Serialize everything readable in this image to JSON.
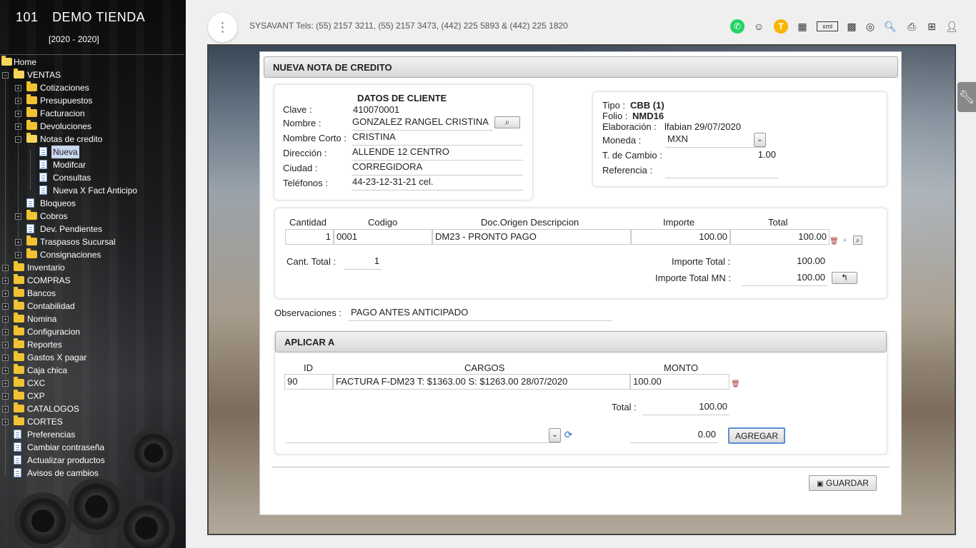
{
  "sidebar": {
    "brand_number": "101",
    "brand_name": "DEMO TIENDA",
    "years": "[2020 - 2020]",
    "tree": {
      "home": "Home",
      "ventas": "VENTAS",
      "cotizaciones": "Cotizaciones",
      "presupuestos": "Presupuestos",
      "facturacion": "Facturacion",
      "devoluciones": "Devoluciones",
      "notas_credito": "Notas de credito",
      "nueva": "Nueva",
      "modifcar": "Modifcar",
      "consultas": "Consultas",
      "nueva_fact": "Nueva X Fact Anticipo",
      "bloqueos": "Bloqueos",
      "cobros": "Cobros",
      "dev_pendientes": "Dev. Pendientes",
      "traspasos": "Traspasos Sucursal",
      "consignaciones": "Consignaciones",
      "inventario": "Inventario",
      "compras": "COMPRAS",
      "bancos": "Bancos",
      "contabilidad": "Contabilidad",
      "nomina": "Nomina",
      "configuracion": "Configuracion",
      "reportes": "Reportes",
      "gastos": "Gastos X pagar",
      "caja": "Caja chica",
      "cxc": "CXC",
      "cxp": "CXP",
      "catalogos": "CATALOGOS",
      "cortes": "CORTES",
      "preferencias": "Preferencias",
      "cambiar": "Cambiar contraseña",
      "actualizar": "Actualizar productos",
      "avisos": "Avisos de cambios"
    }
  },
  "topbar": {
    "menu_glyph": "⋮",
    "contact": "SYSAVANT Tels: (55) 2157 3211, (55) 2157 3473, (442) 225 5893 & (442) 225 1820",
    "icons": [
      "whatsapp-icon",
      "support-icon",
      "user-t-icon",
      "dashboard-icon",
      "xml-icon",
      "qr-icon",
      "target-icon",
      "search-doc-icon",
      "print-icon",
      "new-window-icon",
      "profile-icon"
    ],
    "user_initial": "T",
    "xml_label": "xml"
  },
  "form": {
    "title": "NUEVA NOTA DE CREDITO",
    "cliente": {
      "heading": "DATOS DE CLIENTE",
      "clave_label": "Clave :",
      "clave": "410070001",
      "nombre_label": "Nombre :",
      "nombre": "GONZALEZ RANGEL CRISTINA",
      "nombre_corto_label": "Nombre Corto :",
      "nombre_corto": "CRISTINA",
      "direccion_label": "Dirección :",
      "direccion": "ALLENDE 12 CENTRO",
      "ciudad_label": "Ciudad :",
      "ciudad": "CORREGIDORA",
      "telefonos_label": "Teléfonos :",
      "telefonos": "44-23-12-31-21 cel."
    },
    "doc": {
      "tipo_label": "Tipo :",
      "tipo": "CBB (1)",
      "folio_label": "Folio :",
      "folio": "NMD16",
      "elaboracion_label": "Elaboración :",
      "elaboracion": "lfabian 29/07/2020",
      "moneda_label": "Moneda :",
      "moneda": "MXN",
      "cambio_label": "T. de Cambio :",
      "cambio": "1.00",
      "referencia_label": "Referencia :",
      "referencia": ""
    },
    "items": {
      "headers": {
        "cantidad": "Cantidad",
        "codigo": "Codigo",
        "descripcion": "Doc.Origen Descripcion",
        "importe": "Importe",
        "total": "Total"
      },
      "rows": [
        {
          "cantidad": "1",
          "codigo": "0001",
          "descripcion": "DM23 - PRONTO PAGO",
          "importe": "100.00",
          "total": "100.00"
        }
      ],
      "cant_total_label": "Cant. Total :",
      "cant_total": "1",
      "importe_total_label": "Importe Total :",
      "importe_total": "100.00",
      "importe_total_mn_label": "Importe Total MN :",
      "importe_total_mn": "100.00",
      "back_glyph": "↰"
    },
    "observaciones_label": "Observaciones :",
    "observaciones": "PAGO ANTES ANTICIPADO",
    "aplicar": {
      "title": "APLICAR A",
      "headers": {
        "id": "ID",
        "cargos": "CARGOS",
        "monto": "MONTO"
      },
      "rows": [
        {
          "id": "90",
          "cargos": "FACTURA F-DM23 T: $1363.00 S: $1263.00 28/07/2020",
          "monto": "100.00"
        }
      ],
      "total_label": "Total :",
      "total": "100.00",
      "nuevo_monto": "0.00",
      "agregar_label": "AGREGAR"
    },
    "guardar_label": "GUARDAR"
  }
}
